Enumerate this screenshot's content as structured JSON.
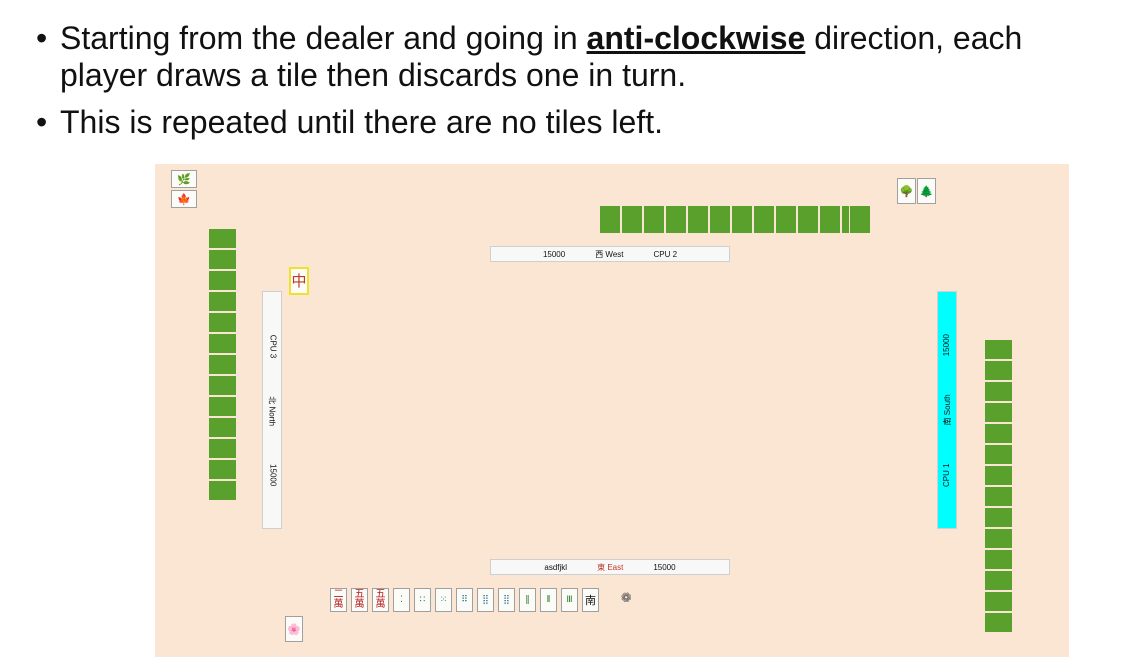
{
  "slide": {
    "bullet1_before": "Starting from the dealer and going in ",
    "bullet1_emphasis": "anti-clockwise",
    "bullet1_after": " direction, each player draws a tile then discards one in turn.",
    "bullet2": "This is repeated until there are no tiles left.",
    "bullet_glyph": "•"
  },
  "game": {
    "west": {
      "score": "15000",
      "wind": "西 West",
      "name": "CPU 2"
    },
    "north": {
      "name": "CPU 3",
      "wind": "北 North",
      "score": "15000"
    },
    "south": {
      "score": "15000",
      "wind": "南 South",
      "name": "CPU 1",
      "highlight_color": "#00ffff"
    },
    "east": {
      "name": "asdfjkl",
      "wind_glyph": "東",
      "wind_label": " East",
      "score": "15000"
    },
    "discard_tile": "中",
    "hand": [
      {
        "icon": "2-character-tile",
        "top": "二",
        "bottom": "萬"
      },
      {
        "icon": "5-character-tile",
        "top": "五",
        "bottom": "萬"
      },
      {
        "icon": "5-character-tile",
        "top": "五",
        "bottom": "萬"
      },
      {
        "icon": "2-dots-tile",
        "glyph": "⁚"
      },
      {
        "icon": "4-dots-tile",
        "glyph": "∷"
      },
      {
        "icon": "5-dots-tile",
        "glyph": "⁙"
      },
      {
        "icon": "6-dots-tile",
        "glyph": "⠿"
      },
      {
        "icon": "8-dots-tile",
        "glyph": "⣿"
      },
      {
        "icon": "9-dots-tile",
        "glyph": "⣿"
      },
      {
        "icon": "2-bamboo-tile",
        "glyph": "‖"
      },
      {
        "icon": "3-bamboo-tile",
        "glyph": "⦀"
      },
      {
        "icon": "6-bamboo-tile",
        "glyph": "Ⅲ"
      },
      {
        "icon": "south-wind-tile",
        "glyph": "南"
      }
    ],
    "colors": {
      "board": "#fae6d2",
      "hidden_tile": "#5aa02c",
      "discard_highlight": "#f0e12a"
    }
  }
}
